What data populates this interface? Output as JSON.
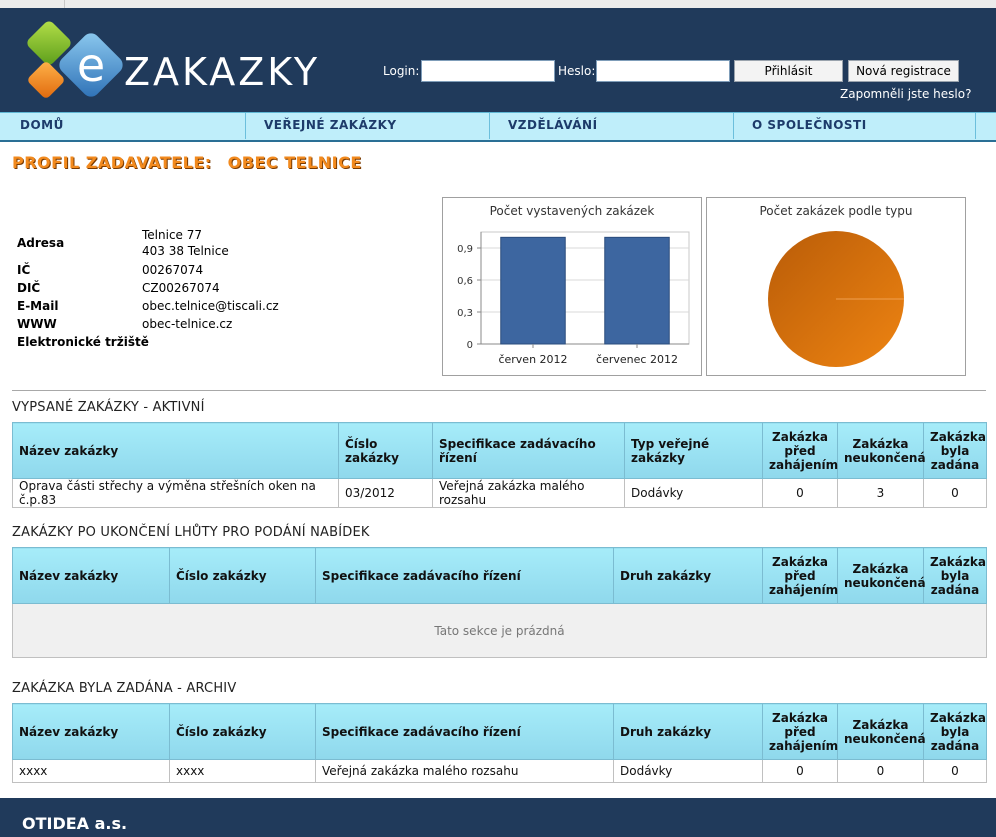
{
  "brand": {
    "logo_text": "ZAKAZKY",
    "logo_mark": "e"
  },
  "login": {
    "login_label": "Login:",
    "password_label": "Heslo:",
    "login_value": "",
    "password_value": "",
    "login_button": "Přihlásit",
    "register_button": "Nová registrace",
    "forgot_link": "Zapomněli jste heslo?"
  },
  "nav": {
    "items": [
      "DOMŮ",
      "VEŘEJNÉ ZAKÁZKY",
      "VZDĚLÁVÁNÍ",
      "O SPOLEČNOSTI"
    ]
  },
  "profile": {
    "title": "PROFIL ZADAVATELE:",
    "name": "OBEC TELNICE"
  },
  "info": {
    "adresa_label": "Adresa",
    "adresa_line1": "Telnice 77",
    "adresa_line2": "403 38 Telnice",
    "ic_label": "IČ",
    "ic_value": "00267074",
    "dic_label": "DIČ",
    "dic_value": "CZ00267074",
    "email_label": "E-Mail",
    "email_value": "obec.telnice@tiscali.cz",
    "www_label": "WWW",
    "www_value": "obec-telnice.cz",
    "market_label": "Elektronické tržiště"
  },
  "chart_data": [
    {
      "type": "bar",
      "title": "Počet vystavených zakázek",
      "categories": [
        "červen 2012",
        "červenec 2012"
      ],
      "values": [
        1,
        1
      ],
      "ylim": [
        0,
        1.05
      ],
      "yticks": [
        "0",
        "0,3",
        "0,6",
        "0,9"
      ],
      "grid": true,
      "color": "#3d66a0"
    },
    {
      "type": "pie",
      "title": "Počet zakázek podle typu",
      "values": [
        1
      ],
      "color": "#d9700c"
    }
  ],
  "sections": {
    "active": {
      "title": "VYPSANÉ ZAKÁZKY - AKTIVNÍ",
      "headers": [
        "Název zakázky",
        "Číslo zakázky",
        "Specifikace zadávacího řízení",
        "Typ veřejné zakázky",
        "Zakázka před zahájením",
        "Zakázka neukončená",
        "Zakázka byla zadána"
      ],
      "rows": [
        [
          "Oprava části střechy a výměna střešních oken na č.p.83",
          "03/2012",
          "Veřejná zakázka malého rozsahu",
          "Dodávky",
          "0",
          "3",
          "0"
        ]
      ]
    },
    "expired": {
      "title": "ZAKÁZKY PO UKONČENÍ LHŮTY PRO PODÁNÍ NABÍDEK",
      "headers": [
        "Název zakázky",
        "Číslo zakázky",
        "Specifikace zadávacího řízení",
        "Druh zakázky",
        "Zakázka před zahájením",
        "Zakázka neukončená",
        "Zakázka byla zadána"
      ],
      "empty_text": "Tato sekce je prázdná"
    },
    "archive": {
      "title": "ZAKÁZKA BYLA ZADÁNA - ARCHIV",
      "headers": [
        "Název zakázky",
        "Číslo zakázky",
        "Specifikace zadávacího řízení",
        "Druh zakázky",
        "Zakázka před zahájením",
        "Zakázka neukončená",
        "Zakázka byla zadána"
      ],
      "rows": [
        [
          "xxxx",
          "xxxx",
          "Veřejná zakázka malého rozsahu",
          "Dodávky",
          "0",
          "0",
          "0"
        ]
      ]
    }
  },
  "footer": {
    "company": "OTIDEA a.s."
  },
  "colors": {
    "header_bg": "#203a5b",
    "nav_bg": "#bfeefa",
    "accent_orange": "#f28a1e",
    "table_header": "#a6ecf9"
  }
}
